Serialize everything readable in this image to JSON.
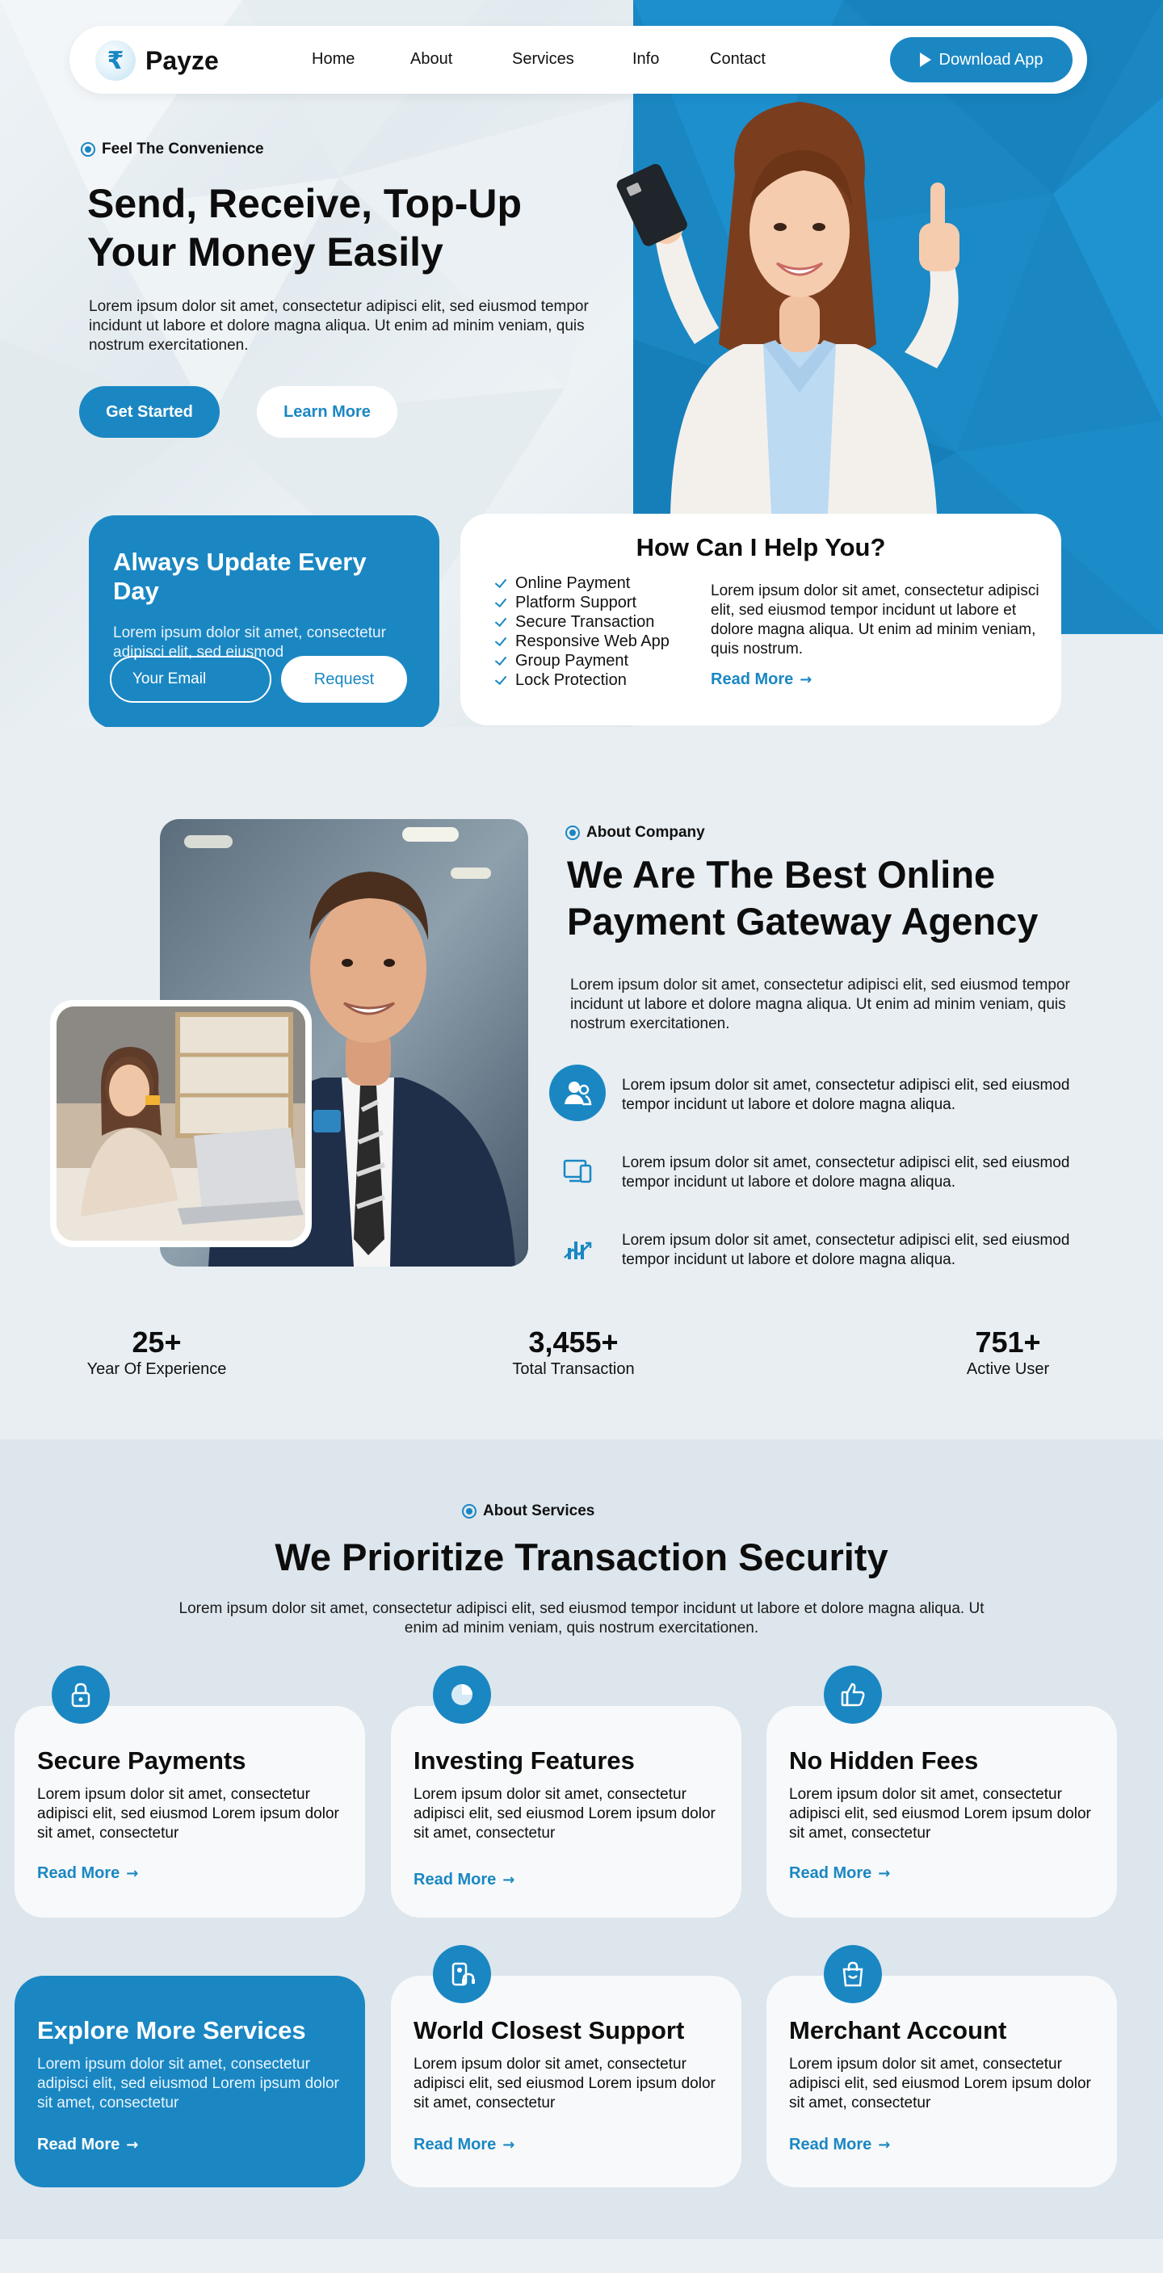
{
  "nav": {
    "logo_text": "Payze",
    "logo_symbol": "₹",
    "links": [
      "Home",
      "About",
      "Services",
      "Info",
      "Contact"
    ],
    "download_label": "Download App"
  },
  "hero": {
    "eyebrow": "Feel The Convenience",
    "title": "Send, Receive, Top-Up Your Money Easily",
    "description": "Lorem ipsum dolor sit amet, consectetur adipisci elit, sed eiusmod tempor incidunt ut labore et dolore magna aliqua. Ut enim ad minim veniam, quis nostrum exercitationen.",
    "primary_button": "Get Started",
    "secondary_button": "Learn More"
  },
  "update_card": {
    "title": "Always Update Every Day",
    "description": "Lorem ipsum dolor sit amet, consectetur adipisci elit, sed eiusmod",
    "email_placeholder": "Your Email",
    "button": "Request"
  },
  "help_card": {
    "title": "How Can I Help You?",
    "items": [
      "Online Payment",
      "Platform Support",
      "Secure Transaction",
      "Responsive Web App",
      "Group Payment",
      "Lock Protection"
    ],
    "description": "Lorem ipsum dolor sit amet, consectetur adipisci elit, sed eiusmod tempor incidunt ut labore et dolore magna aliqua. Ut enim ad minim veniam, quis nostrum.",
    "read_more": "Read More"
  },
  "about": {
    "eyebrow": "About Company",
    "title": "We Are The Best Online Payment Gateway Agency",
    "description": "Lorem ipsum dolor sit amet, consectetur adipisci elit, sed eiusmod tempor incidunt ut labore et dolore magna aliqua. Ut enim ad minim veniam, quis nostrum exercitationen.",
    "features": [
      {
        "icon": "user-group-icon",
        "text": "Lorem ipsum dolor sit amet, consectetur adipisci elit, sed eiusmod tempor incidunt ut labore et dolore magna aliqua."
      },
      {
        "icon": "devices-icon",
        "text": "Lorem ipsum dolor sit amet, consectetur adipisci elit, sed eiusmod tempor incidunt ut labore et dolore magna aliqua."
      },
      {
        "icon": "growth-chart-icon",
        "text": "Lorem ipsum dolor sit amet, consectetur adipisci elit, sed eiusmod tempor incidunt ut labore et dolore magna aliqua."
      }
    ]
  },
  "stats": [
    {
      "value": "25+",
      "label": "Year Of Experience"
    },
    {
      "value": "3,455+",
      "label": "Total Transaction"
    },
    {
      "value": "751+",
      "label": "Active User"
    }
  ],
  "services": {
    "eyebrow": "About Services",
    "title": "We Prioritize Transaction Security",
    "description": "Lorem ipsum dolor sit amet, consectetur adipisci elit, sed eiusmod tempor incidunt ut labore et dolore magna aliqua. Ut enim ad minim veniam, quis nostrum exercitationen.",
    "cards": [
      {
        "title": "Secure Payments",
        "icon": "lock-icon",
        "text": "Lorem ipsum dolor sit amet, consectetur adipisci elit, sed eiusmod Lorem ipsum dolor sit amet, consectetur",
        "read_more": "Read More"
      },
      {
        "title": "Investing Features",
        "icon": "pie-chart-icon",
        "text": "Lorem ipsum dolor sit amet, consectetur adipisci elit, sed eiusmod Lorem ipsum dolor sit amet, consectetur",
        "read_more": "Read More"
      },
      {
        "title": "No Hidden Fees",
        "icon": "thumbs-up-icon",
        "text": "Lorem ipsum dolor sit amet, consectetur adipisci elit, sed eiusmod Lorem ipsum dolor sit amet, consectetur",
        "read_more": "Read More"
      },
      {
        "title": "Explore More Services",
        "icon": "",
        "text": "Lorem ipsum dolor sit amet, consectetur adipisci elit, sed eiusmod Lorem ipsum dolor sit amet, consectetur",
        "read_more": "Read More"
      },
      {
        "title": "World Closest Support",
        "icon": "support-icon",
        "text": "Lorem ipsum dolor sit amet, consectetur adipisci elit, sed eiusmod Lorem ipsum dolor sit amet, consectetur",
        "read_more": "Read More"
      },
      {
        "title": "Merchant Account",
        "icon": "shopping-bag-icon",
        "text": "Lorem ipsum dolor sit amet, consectetur adipisci elit, sed eiusmod Lorem ipsum dolor sit amet, consectetur",
        "read_more": "Read More"
      }
    ]
  },
  "colors": {
    "accent": "#1a87c3",
    "background": "#e8eef2",
    "card": "#ffffff",
    "text": "#0d0d0d"
  }
}
